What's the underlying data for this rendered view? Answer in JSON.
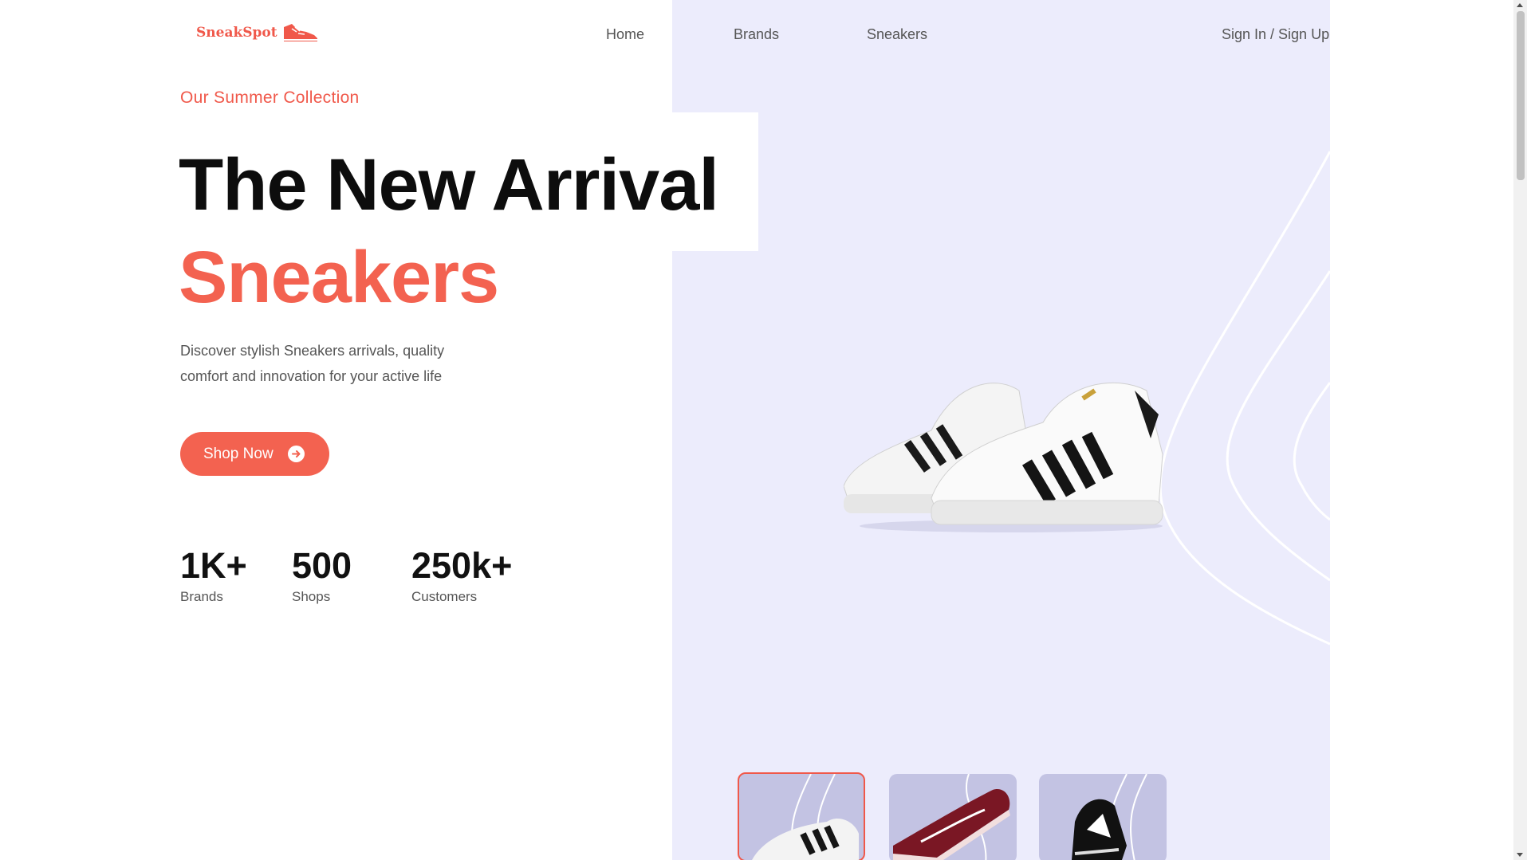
{
  "brand": {
    "name": "SneakSpot",
    "logo_icon": "sneaker-icon"
  },
  "nav": {
    "links": [
      "Home",
      "Brands",
      "Sneakers"
    ],
    "auth": "Sign In / Sign Up"
  },
  "hero": {
    "eyebrow": "Our Summer Collection",
    "headline": "The New Arrival",
    "headline_accent": "Sneakers",
    "description": "Discover stylish Sneakers arrivals, quality comfort and innovation for your active life",
    "cta_label": "Shop Now",
    "cta_icon": "arrow-right-circle-icon"
  },
  "stats": [
    {
      "value": "1K+",
      "label": "Brands"
    },
    {
      "value": "500",
      "label": "Shops"
    },
    {
      "value": "250k+",
      "label": "Customers"
    }
  ],
  "thumbnails": [
    {
      "name": "white-black-stripe-sneaker",
      "active": true
    },
    {
      "name": "burgundy-skate-sneaker",
      "active": false
    },
    {
      "name": "black-patent-sneaker",
      "active": false
    }
  ],
  "colors": {
    "accent": "#f36250",
    "panel": "#ececfc",
    "thumb_bg": "#c3c3e3",
    "text_dark": "#0d0d0d",
    "text_muted": "#555555"
  }
}
